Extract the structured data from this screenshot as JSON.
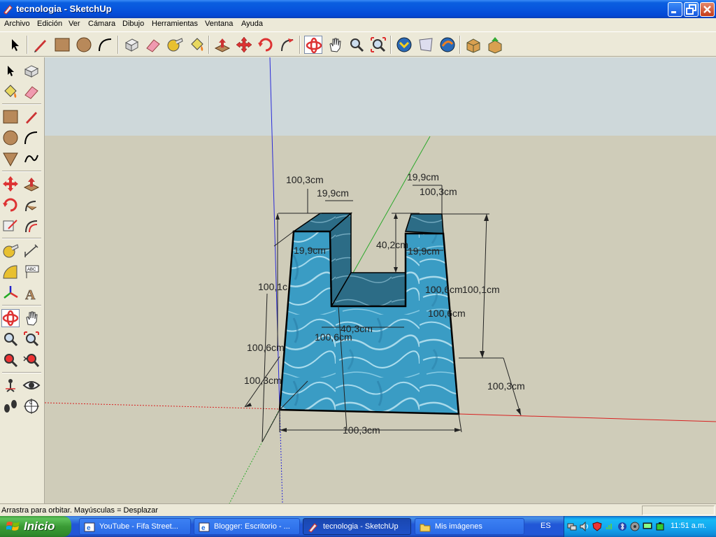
{
  "window": {
    "title": "tecnologia - SketchUp"
  },
  "menu": [
    "Archivo",
    "Edición",
    "Ver",
    "Cámara",
    "Dibujo",
    "Herramientas",
    "Ventana",
    "Ayuda"
  ],
  "toolbar_icons": [
    "select-icon",
    "pencil-icon",
    "rectangle-icon",
    "circle-icon",
    "arc-icon",
    "make-component-icon",
    "eraser-icon",
    "tape-measure-icon",
    "paint-bucket-icon",
    "push-pull-icon",
    "move-icon",
    "rotate-icon",
    "follow-me-icon",
    "orbit-icon",
    "pan-icon",
    "zoom-icon",
    "zoom-extents-icon",
    "previous-view-icon",
    "next-view-icon",
    "get-models-icon",
    "share-model-icon",
    "components-icon",
    "warehouse-icon"
  ],
  "palette_icons": [
    "select-icon",
    "make-component-icon",
    "paint-bucket-icon",
    "eraser-icon",
    "rectangle-icon",
    "line-icon",
    "circle-icon",
    "arc-icon",
    "polygon-icon",
    "freehand-icon",
    "move-icon",
    "push-pull-icon",
    "rotate-icon",
    "follow-me-icon",
    "scale-icon",
    "offset-icon",
    "tape-measure-icon",
    "dimension-icon",
    "protractor-icon",
    "text-icon",
    "axes-icon",
    "3d-text-icon",
    "orbit-icon",
    "pan-icon",
    "zoom-icon",
    "zoom-window-icon",
    "previous-icon",
    "zoom-extents-icon",
    "position-camera-icon",
    "look-around-icon",
    "walk-icon",
    "section-plane-icon"
  ],
  "dimensions": [
    "100,3cm",
    "19,9cm",
    "19,9cm",
    "100,3cm",
    "19,9cm",
    "40,2cm",
    "19,9cm",
    "100,1c",
    "100,6cm",
    "100,1cm",
    "100,6cm",
    "40,3cm",
    "100,6cm",
    "100,6cm",
    "100,3cm",
    "100,3cm",
    "100,3cm"
  ],
  "status": {
    "text": "Arrastra para orbitar.  Mayúsculas = Desplazar"
  },
  "taskbar": {
    "start_label": "Inicio",
    "buttons": [
      {
        "label": "YouTube - Fifa Street..."
      },
      {
        "label": "Blogger: Escritorio - ..."
      },
      {
        "label": "tecnologia - SketchUp"
      },
      {
        "label": "Mis imágenes"
      }
    ],
    "language": "ES",
    "clock": "11:51 a.m."
  },
  "colors": {
    "sky": "#cfd9da",
    "ground": "#cfccb9",
    "water": "#3e9fc4"
  }
}
